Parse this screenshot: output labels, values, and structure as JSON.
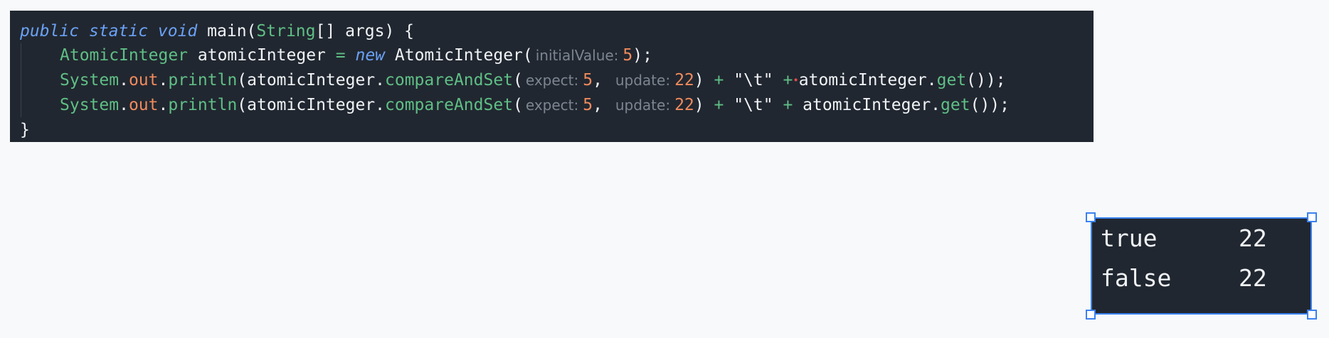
{
  "code": {
    "line1": {
      "kw_public": "public",
      "kw_static": "static",
      "kw_void": "void",
      "name": "main",
      "open": "(",
      "type": "String",
      "brackets": "[]",
      "param": "args",
      "close": ") {"
    },
    "line2": {
      "type": "AtomicInteger",
      "var": "atomicInteger",
      "eq": "=",
      "kw_new": "new",
      "ctor": "AtomicInteger(",
      "hint": "initialValue:",
      "value": "5",
      "end": ");"
    },
    "line3": {
      "system": "System",
      "dot1": ".",
      "out": "out",
      "dot2": ".",
      "println": "println",
      "open": "(atomicInteger.",
      "method": "compareAndSet",
      "paren": "(",
      "hint_expect": "expect:",
      "expect": "5",
      "comma": ",",
      "hint_update": "update:",
      "update": "22",
      "close": ")",
      "plus1": "+",
      "str": "\"\\t\"",
      "plus2": "+",
      "tail_obj": "atomicInteger.",
      "tail_method": "get",
      "tail_end": "());"
    },
    "line4": {
      "system": "System",
      "dot1": ".",
      "out": "out",
      "dot2": ".",
      "println": "println",
      "open": "(atomicInteger.",
      "method": "compareAndSet",
      "paren": "(",
      "hint_expect": "expect:",
      "expect": "5",
      "comma": ",",
      "hint_update": "update:",
      "update": "22",
      "close": ")",
      "plus1": "+",
      "str": "\"\\t\"",
      "plus2": "+",
      "tail_obj": "atomicInteger.",
      "tail_method": "get",
      "tail_end": "());"
    },
    "line5": {
      "brace": "}"
    }
  },
  "output": {
    "rows": [
      {
        "label": "true",
        "value": "22"
      },
      {
        "label": "false",
        "value": "22"
      }
    ]
  },
  "colors": {
    "editor_bg": "#212730",
    "keyword": "#6aa2f6",
    "type": "#5fbf86",
    "number": "#f08a5d",
    "hint": "#7c8591",
    "selection": "#3a82f0"
  }
}
